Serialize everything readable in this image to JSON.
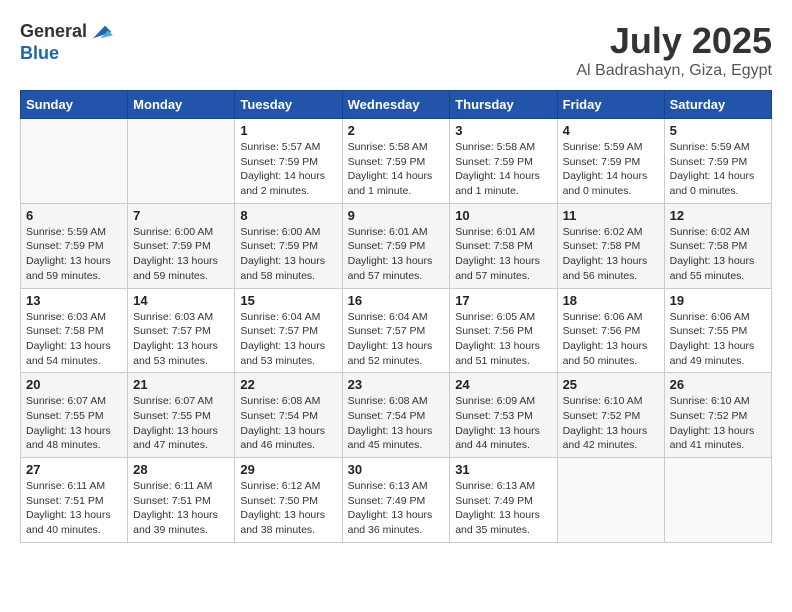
{
  "header": {
    "logo_general": "General",
    "logo_blue": "Blue",
    "month": "July 2025",
    "location": "Al Badrashayn, Giza, Egypt"
  },
  "days_of_week": [
    "Sunday",
    "Monday",
    "Tuesday",
    "Wednesday",
    "Thursday",
    "Friday",
    "Saturday"
  ],
  "weeks": [
    [
      {
        "day": "",
        "info": ""
      },
      {
        "day": "",
        "info": ""
      },
      {
        "day": "1",
        "info": "Sunrise: 5:57 AM\nSunset: 7:59 PM\nDaylight: 14 hours\nand 2 minutes."
      },
      {
        "day": "2",
        "info": "Sunrise: 5:58 AM\nSunset: 7:59 PM\nDaylight: 14 hours\nand 1 minute."
      },
      {
        "day": "3",
        "info": "Sunrise: 5:58 AM\nSunset: 7:59 PM\nDaylight: 14 hours\nand 1 minute."
      },
      {
        "day": "4",
        "info": "Sunrise: 5:59 AM\nSunset: 7:59 PM\nDaylight: 14 hours\nand 0 minutes."
      },
      {
        "day": "5",
        "info": "Sunrise: 5:59 AM\nSunset: 7:59 PM\nDaylight: 14 hours\nand 0 minutes."
      }
    ],
    [
      {
        "day": "6",
        "info": "Sunrise: 5:59 AM\nSunset: 7:59 PM\nDaylight: 13 hours\nand 59 minutes."
      },
      {
        "day": "7",
        "info": "Sunrise: 6:00 AM\nSunset: 7:59 PM\nDaylight: 13 hours\nand 59 minutes."
      },
      {
        "day": "8",
        "info": "Sunrise: 6:00 AM\nSunset: 7:59 PM\nDaylight: 13 hours\nand 58 minutes."
      },
      {
        "day": "9",
        "info": "Sunrise: 6:01 AM\nSunset: 7:59 PM\nDaylight: 13 hours\nand 57 minutes."
      },
      {
        "day": "10",
        "info": "Sunrise: 6:01 AM\nSunset: 7:58 PM\nDaylight: 13 hours\nand 57 minutes."
      },
      {
        "day": "11",
        "info": "Sunrise: 6:02 AM\nSunset: 7:58 PM\nDaylight: 13 hours\nand 56 minutes."
      },
      {
        "day": "12",
        "info": "Sunrise: 6:02 AM\nSunset: 7:58 PM\nDaylight: 13 hours\nand 55 minutes."
      }
    ],
    [
      {
        "day": "13",
        "info": "Sunrise: 6:03 AM\nSunset: 7:58 PM\nDaylight: 13 hours\nand 54 minutes."
      },
      {
        "day": "14",
        "info": "Sunrise: 6:03 AM\nSunset: 7:57 PM\nDaylight: 13 hours\nand 53 minutes."
      },
      {
        "day": "15",
        "info": "Sunrise: 6:04 AM\nSunset: 7:57 PM\nDaylight: 13 hours\nand 53 minutes."
      },
      {
        "day": "16",
        "info": "Sunrise: 6:04 AM\nSunset: 7:57 PM\nDaylight: 13 hours\nand 52 minutes."
      },
      {
        "day": "17",
        "info": "Sunrise: 6:05 AM\nSunset: 7:56 PM\nDaylight: 13 hours\nand 51 minutes."
      },
      {
        "day": "18",
        "info": "Sunrise: 6:06 AM\nSunset: 7:56 PM\nDaylight: 13 hours\nand 50 minutes."
      },
      {
        "day": "19",
        "info": "Sunrise: 6:06 AM\nSunset: 7:55 PM\nDaylight: 13 hours\nand 49 minutes."
      }
    ],
    [
      {
        "day": "20",
        "info": "Sunrise: 6:07 AM\nSunset: 7:55 PM\nDaylight: 13 hours\nand 48 minutes."
      },
      {
        "day": "21",
        "info": "Sunrise: 6:07 AM\nSunset: 7:55 PM\nDaylight: 13 hours\nand 47 minutes."
      },
      {
        "day": "22",
        "info": "Sunrise: 6:08 AM\nSunset: 7:54 PM\nDaylight: 13 hours\nand 46 minutes."
      },
      {
        "day": "23",
        "info": "Sunrise: 6:08 AM\nSunset: 7:54 PM\nDaylight: 13 hours\nand 45 minutes."
      },
      {
        "day": "24",
        "info": "Sunrise: 6:09 AM\nSunset: 7:53 PM\nDaylight: 13 hours\nand 44 minutes."
      },
      {
        "day": "25",
        "info": "Sunrise: 6:10 AM\nSunset: 7:52 PM\nDaylight: 13 hours\nand 42 minutes."
      },
      {
        "day": "26",
        "info": "Sunrise: 6:10 AM\nSunset: 7:52 PM\nDaylight: 13 hours\nand 41 minutes."
      }
    ],
    [
      {
        "day": "27",
        "info": "Sunrise: 6:11 AM\nSunset: 7:51 PM\nDaylight: 13 hours\nand 40 minutes."
      },
      {
        "day": "28",
        "info": "Sunrise: 6:11 AM\nSunset: 7:51 PM\nDaylight: 13 hours\nand 39 minutes."
      },
      {
        "day": "29",
        "info": "Sunrise: 6:12 AM\nSunset: 7:50 PM\nDaylight: 13 hours\nand 38 minutes."
      },
      {
        "day": "30",
        "info": "Sunrise: 6:13 AM\nSunset: 7:49 PM\nDaylight: 13 hours\nand 36 minutes."
      },
      {
        "day": "31",
        "info": "Sunrise: 6:13 AM\nSunset: 7:49 PM\nDaylight: 13 hours\nand 35 minutes."
      },
      {
        "day": "",
        "info": ""
      },
      {
        "day": "",
        "info": ""
      }
    ]
  ]
}
